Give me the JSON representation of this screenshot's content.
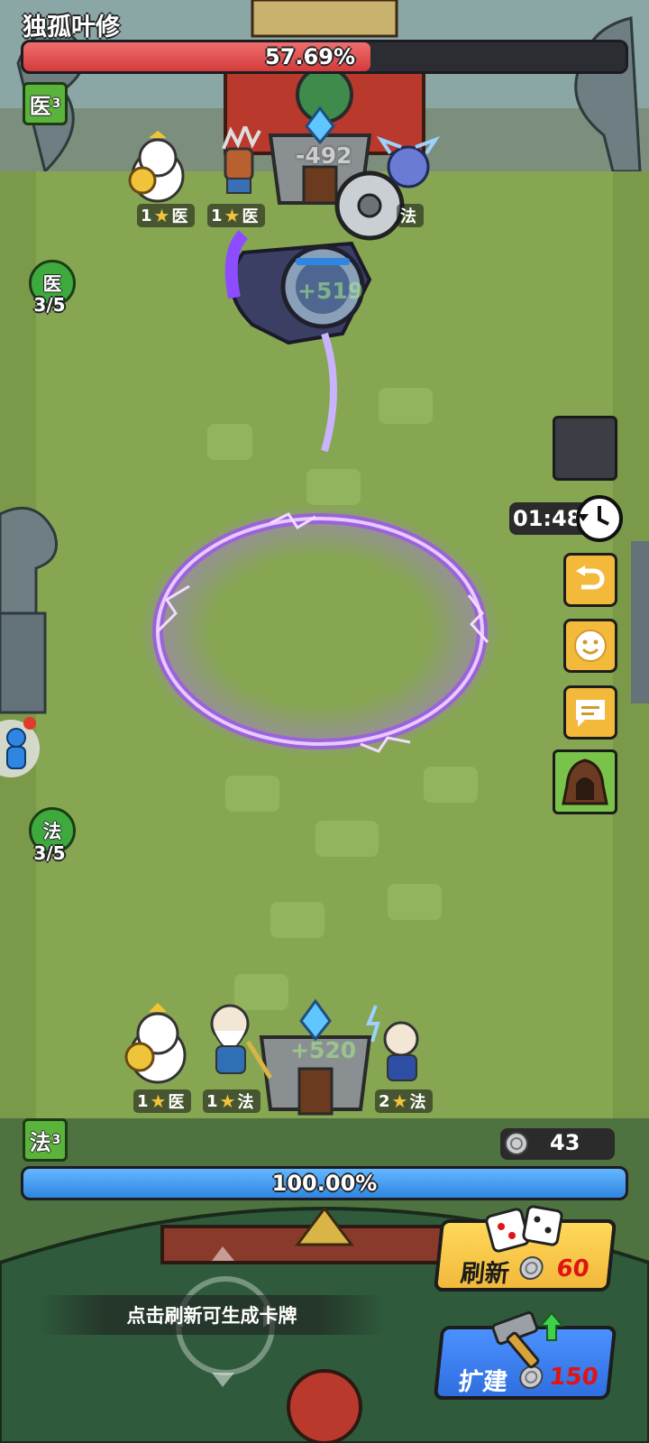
{
  "enemy": {
    "name": "独孤叶修",
    "hp_percent": "57.69%",
    "class_badge": {
      "label": "医",
      "level": "3"
    },
    "synergy": {
      "label": "医",
      "count": "3/5"
    },
    "units": [
      {
        "stars": "1",
        "class": "医"
      },
      {
        "stars": "1",
        "class": "医"
      },
      {
        "class": "法"
      }
    ],
    "floating_numbers": [
      "-492",
      "+519"
    ]
  },
  "player": {
    "hp_percent": "100.00%",
    "class_badge": {
      "label": "法",
      "level": "3"
    },
    "synergy": {
      "label": "法",
      "count": "3/5"
    },
    "units": [
      {
        "stars": "1",
        "class": "医"
      },
      {
        "stars": "1",
        "class": "法"
      },
      {
        "stars": "2",
        "class": "法"
      }
    ],
    "floating_numbers": [
      "+520"
    ],
    "coins": "43"
  },
  "timer": "01:48",
  "side_buttons": [
    "undo-icon",
    "emoji-icon",
    "chat-icon",
    "hooded-figure-icon"
  ],
  "actions": {
    "refresh": {
      "label": "刷新",
      "cost": "60"
    },
    "build": {
      "label": "扩建",
      "cost": "150"
    }
  },
  "hint": "点击刷新可生成卡牌",
  "colors": {
    "enemy_hp": "#d33b3b",
    "player_hp": "#2f86e0",
    "refresh_button": "#f2c23b",
    "build_button": "#2f6fe0",
    "portal": "#a050ff"
  }
}
